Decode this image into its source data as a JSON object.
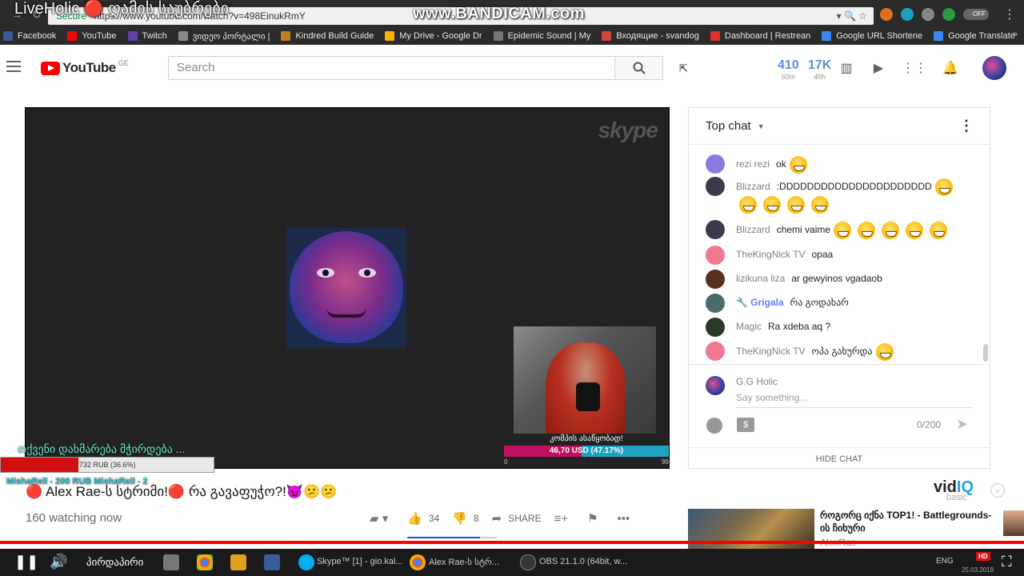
{
  "overlay": {
    "stream_title": "LiveHolic 🔴 ღამის საუბრები",
    "watermark": "www.BANDICAM.com"
  },
  "browser": {
    "secure_label": "Secure",
    "url": "https://www.youtube.com/watch?v=498EinukRmY",
    "toggle_label": "OFF",
    "bookmarks": [
      {
        "label": "Facebook",
        "color": "#3b5998"
      },
      {
        "label": "YouTube",
        "color": "#ff0000"
      },
      {
        "label": "Twitch",
        "color": "#6441a5"
      },
      {
        "label": "ვიდეო პორტალი |",
        "color": "#888888"
      },
      {
        "label": "Kindred Build Guide",
        "color": "#c08020"
      },
      {
        "label": "My Drive - Google Dr",
        "color": "#f4b400"
      },
      {
        "label": "Epidemic Sound | My",
        "color": "#777777"
      },
      {
        "label": "Входящие - svandog",
        "color": "#d44638"
      },
      {
        "label": "Dashboard | Restrean",
        "color": "#e0302a"
      },
      {
        "label": "Google URL Shortene",
        "color": "#4285f4"
      },
      {
        "label": "Google Translate",
        "color": "#4285f4"
      }
    ]
  },
  "masthead": {
    "logo_text": "YouTube",
    "region": "GE",
    "search_placeholder": "Search",
    "stat_viewers": {
      "num": "410",
      "label": "60m"
    },
    "stat_views": {
      "num": "17K",
      "label": "48h"
    }
  },
  "player": {
    "skype_label": "skype",
    "donation_label": "კომპის ასაწყობად!",
    "donation_text": "46,70 USD (47.17%)",
    "donation_fraction": 0.4717,
    "donation_min": "0",
    "donation_max": "99",
    "help_text": "თქვენი დახმარება მჭირდება ...",
    "rub_text": "732 RUB (36.6%)",
    "rub_fraction": 0.366,
    "donors_text": "MishaRell - 200 RUB          MishaRell - 2"
  },
  "video": {
    "title": "🔴 Alex Rae-ს სტრიმი!🔴 რა გავაფუჭო?!😈😕😕",
    "view_count": "160 watching now",
    "likes": "34",
    "dislikes": "8",
    "share_label": "SHARE",
    "like_ratio": 0.81
  },
  "chat": {
    "header": "Top chat",
    "messages": [
      {
        "author": "rezi rezi",
        "text": "ok",
        "emojis": 1,
        "avatar": "#8a7be0",
        "moderator": false
      },
      {
        "author": "Blizzard",
        "text": ":DDDDDDDDDDDDDDDDDDDDDD",
        "emojis": 5,
        "avatar": "#3a3a4a",
        "moderator": false
      },
      {
        "author": "Blizzard",
        "text": "chemi vaime",
        "emojis": 5,
        "avatar": "#3a3a4a",
        "moderator": false
      },
      {
        "author": "TheKingNick TV",
        "text": "opaa",
        "emojis": 0,
        "avatar": "#f07890",
        "moderator": false
      },
      {
        "author": "lizikuna liza",
        "text": "ar gewyinos vgadaob",
        "emojis": 0,
        "avatar": "#5a3020",
        "moderator": false
      },
      {
        "author": "Grigala",
        "text": "რა გოდახარ",
        "emojis": 0,
        "avatar": "#4a6a70",
        "moderator": true
      },
      {
        "author": "Magic",
        "text": "Ra xdeba aq ?",
        "emojis": 0,
        "avatar": "#2a3a2a",
        "moderator": false
      },
      {
        "author": "TheKingNick TV",
        "text": "ოპა გახურდა",
        "emojis": 1,
        "avatar": "#f07890",
        "moderator": false
      }
    ],
    "input_user": "G.G Holic",
    "input_placeholder": "Say something...",
    "char_count": "0/200",
    "hide_chat": "HIDE CHAT"
  },
  "vidiq": {
    "brand_a": "vid",
    "brand_b": "IQ",
    "tier": "basic"
  },
  "recommended": {
    "title": "როგორც იქნა TOP1! - Battlegrounds-ის ჩიხური",
    "channel": "AlexRae"
  },
  "taskbar": {
    "label": "პირდაპირი",
    "tasks": [
      "Skype™ [1] - gio.kal...",
      "Alex Rae-ს სტრ...",
      "OBS 21.1.0 (64bit, w..."
    ],
    "lang": "ENG",
    "date": "25.03.2018",
    "hd": "HD"
  }
}
